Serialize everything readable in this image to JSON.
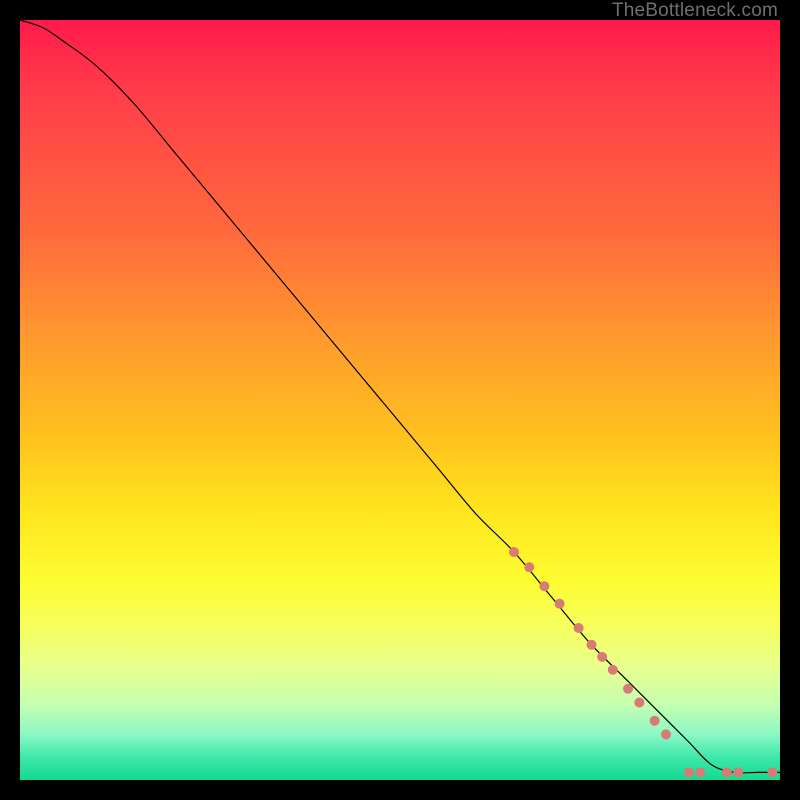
{
  "attribution": "TheBottleneck.com",
  "colors": {
    "curve": "#000000",
    "marker_fill": "#d97a74",
    "marker_stroke": "#c9625c"
  },
  "chart_data": {
    "type": "line",
    "title": "",
    "xlabel": "",
    "ylabel": "",
    "xlim": [
      0,
      100
    ],
    "ylim": [
      0,
      100
    ],
    "grid": false,
    "series": [
      {
        "name": "curve",
        "x": [
          0,
          3,
          6,
          10,
          15,
          20,
          25,
          30,
          35,
          40,
          45,
          50,
          55,
          60,
          65,
          70,
          75,
          80,
          85,
          88,
          91,
          94,
          97,
          100
        ],
        "y": [
          100,
          99,
          97,
          94,
          89,
          83,
          77,
          71,
          65,
          59,
          53,
          47,
          41,
          35,
          30,
          24,
          18,
          13,
          8,
          5,
          2,
          1,
          1,
          1
        ],
        "stroke_width": 1.2
      }
    ],
    "markers": [
      {
        "x": 65,
        "y": 30,
        "r": 5
      },
      {
        "x": 67,
        "y": 28,
        "r": 5
      },
      {
        "x": 69,
        "y": 25.5,
        "r": 5
      },
      {
        "x": 71,
        "y": 23.2,
        "r": 5
      },
      {
        "x": 73.5,
        "y": 20,
        "r": 5
      },
      {
        "x": 75.2,
        "y": 17.8,
        "r": 5
      },
      {
        "x": 76.6,
        "y": 16.2,
        "r": 5
      },
      {
        "x": 78,
        "y": 14.5,
        "r": 5
      },
      {
        "x": 80,
        "y": 12,
        "r": 5
      },
      {
        "x": 81.5,
        "y": 10.2,
        "r": 5
      },
      {
        "x": 83.5,
        "y": 7.8,
        "r": 5
      },
      {
        "x": 85,
        "y": 6,
        "r": 5
      },
      {
        "x": 88,
        "y": 1,
        "r": 5
      },
      {
        "x": 89.5,
        "y": 1,
        "r": 5
      },
      {
        "x": 93,
        "y": 1,
        "r": 5
      },
      {
        "x": 94.5,
        "y": 1,
        "r": 5
      },
      {
        "x": 99,
        "y": 1,
        "r": 5
      }
    ]
  }
}
